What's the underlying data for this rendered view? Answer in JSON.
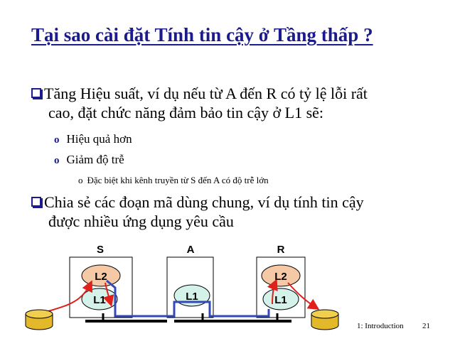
{
  "title": "Tại sao cài đặt Tính tin cậy ở Tầng thấp ?",
  "bullets": [
    {
      "line1": "Tăng Hiệu suất, ví dụ nếu từ A đến R có tỷ lệ lỗi rất",
      "line2": "cao, đặt chức năng đảm bảo tin cậy ở L1 sẽ:",
      "sub": [
        {
          "marker": "o",
          "text": "Hiệu quả hơn"
        },
        {
          "marker": "o",
          "text": "Giảm độ trễ"
        }
      ],
      "subsub": [
        {
          "marker": "o",
          "text": "Đặc biệt khi kênh truyền từ S đến A có độ trễ lớn"
        }
      ]
    },
    {
      "line1": "Chia sẻ các đoạn mã dùng chung, ví dụ tính tin cậy",
      "line2": "được nhiều ứng dụng yêu cầu"
    }
  ],
  "diagram": {
    "nodes": [
      {
        "name": "S",
        "layers": [
          "L2",
          "L1"
        ]
      },
      {
        "name": "A",
        "layers": [
          "L1"
        ]
      },
      {
        "name": "R",
        "layers": [
          "L2",
          "L1"
        ]
      }
    ],
    "colors": {
      "l2_fill": "#f5c9a6",
      "l1_fill": "#d4f2e9",
      "path": "#3548b8",
      "arrow": "#e0201a",
      "disk": "#e3b92a"
    }
  },
  "footer": {
    "section": "1: Introduction",
    "page": "21"
  }
}
